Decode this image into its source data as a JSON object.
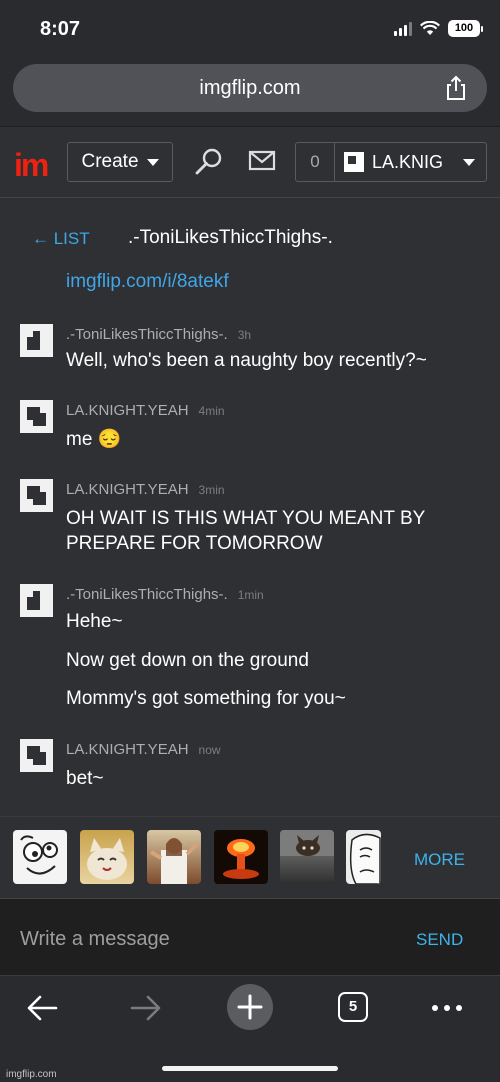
{
  "status_bar": {
    "time": "8:07",
    "battery": "100"
  },
  "browser": {
    "url": "imgflip.com",
    "tab_count": "5"
  },
  "header": {
    "logo": "im",
    "create_label": "Create",
    "notification_count": "0",
    "username": "LA.KNIG"
  },
  "chat": {
    "back_label": "← LIST",
    "title": ".-ToniLikesThiccThighs-.",
    "prev_link": "imgflip.com/i/8atekf",
    "messages": [
      {
        "user": ".-ToniLikesThiccThighs-.",
        "time": "3h",
        "lines": [
          "Well, who's been a naughty boy recently?~"
        ]
      },
      {
        "user": "LA.KNIGHT.YEAH",
        "time": "4min",
        "lines": [
          "me 😔"
        ]
      },
      {
        "user": "LA.KNIGHT.YEAH",
        "time": "3min",
        "lines": [
          "OH WAIT IS THIS WHAT YOU MEANT BY",
          "PREPARE FOR TOMORROW"
        ]
      },
      {
        "user": ".-ToniLikesThiccThighs-.",
        "time": "1min",
        "lines": [
          "Hehe~",
          "Now get down on the ground",
          "Mommy's got something for you~"
        ]
      },
      {
        "user": "LA.KNIGHT.YEAH",
        "time": "now",
        "lines": [
          "bet~"
        ]
      }
    ]
  },
  "meme_strip": {
    "items": [
      "derp-meme",
      "happy-cat-meme",
      "buddy-christ-meme",
      "nuclear-explosion-meme",
      "ceiling-cat-meme",
      "okay-guy-meme"
    ],
    "more_label": "MORE"
  },
  "compose": {
    "placeholder": "Write a message",
    "send_label": "SEND"
  },
  "watermark": "imgflip.com",
  "colors": {
    "link": "#3fa6e8",
    "logo": "#e21",
    "background": "#2f3033"
  }
}
